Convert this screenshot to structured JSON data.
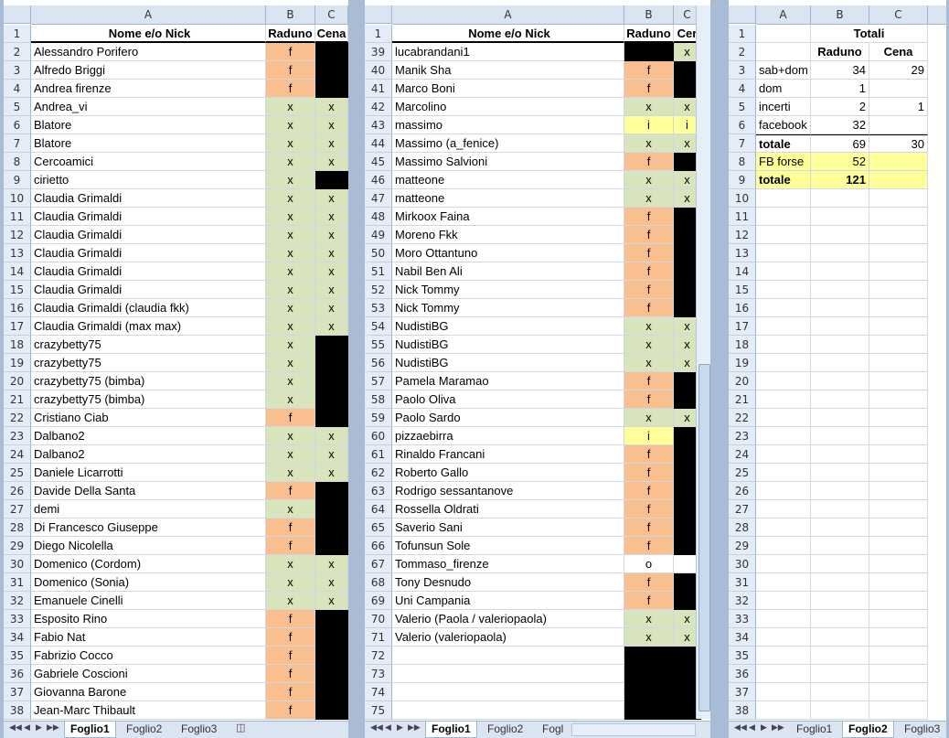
{
  "columns": {
    "row_corner": "",
    "a": "A",
    "b": "B",
    "c": "C"
  },
  "pane1": {
    "headers": {
      "name": "Nome e/o Nick",
      "raduno": "Raduno",
      "cena": "Cena"
    },
    "rows": [
      {
        "n": "2",
        "name": "Alessandro Porifero",
        "raduno": "f",
        "cena": ""
      },
      {
        "n": "3",
        "name": "Alfredo Briggi",
        "raduno": "f",
        "cena": ""
      },
      {
        "n": "4",
        "name": "Andrea firenze",
        "raduno": "f",
        "cena": ""
      },
      {
        "n": "5",
        "name": "Andrea_vi",
        "raduno": "x",
        "cena": "x"
      },
      {
        "n": "6",
        "name": "Blatore",
        "raduno": "x",
        "cena": "x"
      },
      {
        "n": "7",
        "name": "Blatore",
        "raduno": "x",
        "cena": "x"
      },
      {
        "n": "8",
        "name": "Cercoamici",
        "raduno": "x",
        "cena": "x"
      },
      {
        "n": "9",
        "name": "cirietto",
        "raduno": "x",
        "cena": ""
      },
      {
        "n": "10",
        "name": "Claudia Grimaldi",
        "raduno": "x",
        "cena": "x"
      },
      {
        "n": "11",
        "name": "Claudia Grimaldi",
        "raduno": "x",
        "cena": "x"
      },
      {
        "n": "12",
        "name": "Claudia Grimaldi",
        "raduno": "x",
        "cena": "x"
      },
      {
        "n": "13",
        "name": "Claudia Grimaldi",
        "raduno": "x",
        "cena": "x"
      },
      {
        "n": "14",
        "name": "Claudia Grimaldi",
        "raduno": "x",
        "cena": "x"
      },
      {
        "n": "15",
        "name": "Claudia Grimaldi",
        "raduno": "x",
        "cena": "x"
      },
      {
        "n": "16",
        "name": "Claudia Grimaldi (claudia fkk)",
        "raduno": "x",
        "cena": "x"
      },
      {
        "n": "17",
        "name": "Claudia Grimaldi (max max)",
        "raduno": "x",
        "cena": "x"
      },
      {
        "n": "18",
        "name": "crazybetty75",
        "raduno": "x",
        "cena": ""
      },
      {
        "n": "19",
        "name": "crazybetty75",
        "raduno": "x",
        "cena": ""
      },
      {
        "n": "20",
        "name": "crazybetty75 (bimba)",
        "raduno": "x",
        "cena": ""
      },
      {
        "n": "21",
        "name": "crazybetty75 (bimba)",
        "raduno": "x",
        "cena": ""
      },
      {
        "n": "22",
        "name": "Cristiano Ciab",
        "raduno": "f",
        "cena": ""
      },
      {
        "n": "23",
        "name": "Dalbano2",
        "raduno": "x",
        "cena": "x"
      },
      {
        "n": "24",
        "name": "Dalbano2",
        "raduno": "x",
        "cena": "x"
      },
      {
        "n": "25",
        "name": "Daniele Licarrotti",
        "raduno": "x",
        "cena": "x"
      },
      {
        "n": "26",
        "name": "Davide Della Santa",
        "raduno": "f",
        "cena": ""
      },
      {
        "n": "27",
        "name": "demi",
        "raduno": "x",
        "cena": ""
      },
      {
        "n": "28",
        "name": "Di Francesco Giuseppe",
        "raduno": "f",
        "cena": ""
      },
      {
        "n": "29",
        "name": "Diego Nicolella",
        "raduno": "f",
        "cena": ""
      },
      {
        "n": "30",
        "name": "Domenico (Cordom)",
        "raduno": "x",
        "cena": "x"
      },
      {
        "n": "31",
        "name": "Domenico (Sonia)",
        "raduno": "x",
        "cena": "x"
      },
      {
        "n": "32",
        "name": "Emanuele Cinelli",
        "raduno": "x",
        "cena": "x"
      },
      {
        "n": "33",
        "name": "Esposito Rino",
        "raduno": "f",
        "cena": ""
      },
      {
        "n": "34",
        "name": "Fabio Nat",
        "raduno": "f",
        "cena": ""
      },
      {
        "n": "35",
        "name": "Fabrizio Cocco",
        "raduno": "f",
        "cena": ""
      },
      {
        "n": "36",
        "name": "Gabriele Coscioni",
        "raduno": "f",
        "cena": ""
      },
      {
        "n": "37",
        "name": "Giovanna Barone",
        "raduno": "f",
        "cena": ""
      },
      {
        "n": "38",
        "name": "Jean-Marc Thibault",
        "raduno": "f",
        "cena": ""
      }
    ],
    "tabs": [
      "Foglio1",
      "Foglio2",
      "Foglio3"
    ]
  },
  "pane2": {
    "headers": {
      "name": "Nome e/o Nick",
      "raduno": "Raduno",
      "cena": "Cer"
    },
    "rows": [
      {
        "n": "39",
        "name": "lucabrandani1",
        "raduno": "",
        "cena": "x"
      },
      {
        "n": "40",
        "name": "Manik Sha",
        "raduno": "f",
        "cena": ""
      },
      {
        "n": "41",
        "name": "Marco Boni",
        "raduno": "f",
        "cena": ""
      },
      {
        "n": "42",
        "name": "Marcolino",
        "raduno": "x",
        "cena": "x"
      },
      {
        "n": "43",
        "name": "massimo",
        "raduno": "i",
        "cena": "i"
      },
      {
        "n": "44",
        "name": "Massimo (a_fenice)",
        "raduno": "x",
        "cena": "x"
      },
      {
        "n": "45",
        "name": "Massimo Salvioni",
        "raduno": "f",
        "cena": ""
      },
      {
        "n": "46",
        "name": "matteone",
        "raduno": "x",
        "cena": "x"
      },
      {
        "n": "47",
        "name": "matteone",
        "raduno": "x",
        "cena": "x"
      },
      {
        "n": "48",
        "name": "Mirkoox Faina",
        "raduno": "f",
        "cena": ""
      },
      {
        "n": "49",
        "name": "Moreno Fkk",
        "raduno": "f",
        "cena": ""
      },
      {
        "n": "50",
        "name": "Moro Ottantuno",
        "raduno": "f",
        "cena": ""
      },
      {
        "n": "51",
        "name": "Nabil Ben Ali",
        "raduno": "f",
        "cena": ""
      },
      {
        "n": "52",
        "name": "Nick Tommy",
        "raduno": "f",
        "cena": ""
      },
      {
        "n": "53",
        "name": "Nick Tommy",
        "raduno": "f",
        "cena": ""
      },
      {
        "n": "54",
        "name": "NudistiBG",
        "raduno": "x",
        "cena": "x"
      },
      {
        "n": "55",
        "name": "NudistiBG",
        "raduno": "x",
        "cena": "x"
      },
      {
        "n": "56",
        "name": "NudistiBG",
        "raduno": "x",
        "cena": "x"
      },
      {
        "n": "57",
        "name": "Pamela Maramao",
        "raduno": "f",
        "cena": ""
      },
      {
        "n": "58",
        "name": "Paolo Oliva",
        "raduno": "f",
        "cena": ""
      },
      {
        "n": "59",
        "name": "Paolo Sardo",
        "raduno": "x",
        "cena": "x"
      },
      {
        "n": "60",
        "name": "pizzaebirra",
        "raduno": "i",
        "cena": ""
      },
      {
        "n": "61",
        "name": "Rinaldo Francani",
        "raduno": "f",
        "cena": ""
      },
      {
        "n": "62",
        "name": "Roberto Gallo",
        "raduno": "f",
        "cena": ""
      },
      {
        "n": "63",
        "name": "Rodrigo sessantanove",
        "raduno": "f",
        "cena": ""
      },
      {
        "n": "64",
        "name": "Rossella Oldrati",
        "raduno": "f",
        "cena": ""
      },
      {
        "n": "65",
        "name": "Saverio Sani",
        "raduno": "f",
        "cena": ""
      },
      {
        "n": "66",
        "name": "Tofunsun Sole",
        "raduno": "f",
        "cena": ""
      },
      {
        "n": "67",
        "name": "Tommaso_firenze",
        "raduno": "o",
        "cena": ""
      },
      {
        "n": "68",
        "name": "Tony Desnudo",
        "raduno": "f",
        "cena": ""
      },
      {
        "n": "69",
        "name": "Uni Campania",
        "raduno": "f",
        "cena": ""
      },
      {
        "n": "70",
        "name": "Valerio (Paola / valeriopaola)",
        "raduno": "x",
        "cena": "x"
      },
      {
        "n": "71",
        "name": "Valerio (valeriopaola)",
        "raduno": "x",
        "cena": "x"
      },
      {
        "n": "72",
        "name": "",
        "raduno": "",
        "cena": ""
      },
      {
        "n": "73",
        "name": "",
        "raduno": "",
        "cena": ""
      },
      {
        "n": "74",
        "name": "",
        "raduno": "",
        "cena": ""
      },
      {
        "n": "75",
        "name": "",
        "raduno": "",
        "cena": ""
      }
    ],
    "tabs": [
      "Foglio1",
      "Foglio2",
      "Fogl"
    ]
  },
  "pane3": {
    "rows": [
      {
        "n": "1",
        "a": "",
        "b": "Totali",
        "c": ""
      },
      {
        "n": "2",
        "a": "",
        "b": "Raduno",
        "c": "Cena"
      },
      {
        "n": "3",
        "a": "sab+dom",
        "b": "34",
        "c": "29"
      },
      {
        "n": "4",
        "a": "dom",
        "b": "1",
        "c": ""
      },
      {
        "n": "5",
        "a": "incerti",
        "b": "2",
        "c": "1"
      },
      {
        "n": "6",
        "a": "facebook",
        "b": "32",
        "c": ""
      },
      {
        "n": "7",
        "a": "totale",
        "b": "69",
        "c": "30"
      },
      {
        "n": "8",
        "a": "FB forse",
        "b": "52",
        "c": ""
      },
      {
        "n": "9",
        "a": "totale",
        "b": "121",
        "c": ""
      },
      {
        "n": "10",
        "a": "",
        "b": "",
        "c": ""
      },
      {
        "n": "11",
        "a": "",
        "b": "",
        "c": ""
      },
      {
        "n": "12",
        "a": "",
        "b": "",
        "c": ""
      },
      {
        "n": "13",
        "a": "",
        "b": "",
        "c": ""
      },
      {
        "n": "14",
        "a": "",
        "b": "",
        "c": ""
      },
      {
        "n": "15",
        "a": "",
        "b": "",
        "c": ""
      },
      {
        "n": "16",
        "a": "",
        "b": "",
        "c": ""
      },
      {
        "n": "17",
        "a": "",
        "b": "",
        "c": ""
      },
      {
        "n": "18",
        "a": "",
        "b": "",
        "c": ""
      },
      {
        "n": "19",
        "a": "",
        "b": "",
        "c": ""
      },
      {
        "n": "20",
        "a": "",
        "b": "",
        "c": ""
      },
      {
        "n": "21",
        "a": "",
        "b": "",
        "c": ""
      },
      {
        "n": "22",
        "a": "",
        "b": "",
        "c": ""
      },
      {
        "n": "23",
        "a": "",
        "b": "",
        "c": ""
      },
      {
        "n": "24",
        "a": "",
        "b": "",
        "c": ""
      },
      {
        "n": "25",
        "a": "",
        "b": "",
        "c": ""
      },
      {
        "n": "26",
        "a": "",
        "b": "",
        "c": ""
      },
      {
        "n": "27",
        "a": "",
        "b": "",
        "c": ""
      },
      {
        "n": "28",
        "a": "",
        "b": "",
        "c": ""
      },
      {
        "n": "29",
        "a": "",
        "b": "",
        "c": ""
      },
      {
        "n": "30",
        "a": "",
        "b": "",
        "c": ""
      },
      {
        "n": "31",
        "a": "",
        "b": "",
        "c": ""
      },
      {
        "n": "32",
        "a": "",
        "b": "",
        "c": ""
      },
      {
        "n": "33",
        "a": "",
        "b": "",
        "c": ""
      },
      {
        "n": "34",
        "a": "",
        "b": "",
        "c": ""
      },
      {
        "n": "35",
        "a": "",
        "b": "",
        "c": ""
      },
      {
        "n": "36",
        "a": "",
        "b": "",
        "c": ""
      },
      {
        "n": "37",
        "a": "",
        "b": "",
        "c": ""
      },
      {
        "n": "38",
        "a": "",
        "b": "",
        "c": ""
      }
    ],
    "tabs": [
      "Foglio1",
      "Foglio2",
      "Foglio3"
    ]
  },
  "colors": {
    "f": "#fabf8f",
    "x": "#d8e4bc",
    "i": "#ffff99",
    "blank": "#000000"
  },
  "icons": {
    "nav_first": "first-sheet-icon",
    "nav_prev": "prev-sheet-icon",
    "nav_next": "next-sheet-icon",
    "nav_last": "last-sheet-icon",
    "new_sheet": "insert-sheet-icon"
  }
}
